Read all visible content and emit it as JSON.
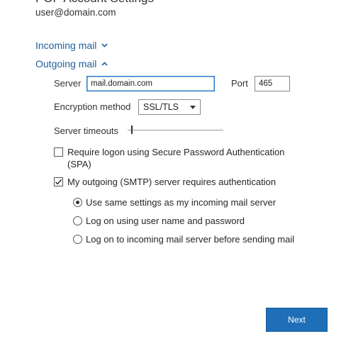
{
  "header": {
    "title": "POP Account Settings",
    "email": "user@domain.com"
  },
  "sections": {
    "incoming": {
      "label": "Incoming mail",
      "icon": "chevron-down-icon",
      "expanded": false
    },
    "outgoing": {
      "label": "Outgoing mail",
      "icon": "chevron-up-icon",
      "expanded": true
    }
  },
  "outgoing": {
    "server_label": "Server",
    "server_value": "mail.domain.com",
    "port_label": "Port",
    "port_value": "465",
    "encryption_label": "Encryption method",
    "encryption_value": "SSL/TLS",
    "timeouts_label": "Server timeouts",
    "timeouts_level": 0.04,
    "spa_label_line1": "Require logon using Secure Password Authentication",
    "spa_label_line2": "(SPA)",
    "spa_checked": false,
    "smtp_auth_label": "My outgoing (SMTP) server requires authentication",
    "smtp_auth_checked": true,
    "auth_options": [
      {
        "label": "Use same settings as my incoming mail server",
        "selected": true
      },
      {
        "label": "Log on using user name and password",
        "selected": false
      },
      {
        "label": "Log on to incoming mail server before sending mail",
        "selected": false
      }
    ]
  },
  "footer": {
    "next_label": "Next"
  },
  "colors": {
    "link": "#1f5f9e",
    "button": "#1f6fb8",
    "focus_border": "#2b79c6"
  }
}
